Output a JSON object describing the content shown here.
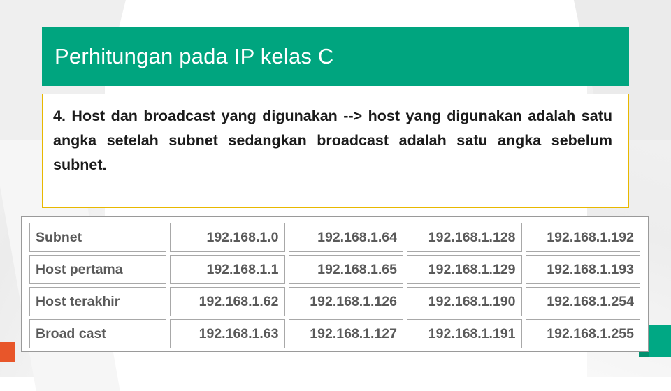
{
  "slide": {
    "title": "Perhitungan pada IP kelas C",
    "body": "4. Host dan broadcast yang digunakan --> host yang digunakan adalah satu angka setelah subnet sedangkan broadcast adalah satu angka sebelum subnet.",
    "accent_green": "#00a57f",
    "accent_yellow": "#e8b800",
    "accent_orange": "#e8562a"
  },
  "table": {
    "rows": [
      {
        "label": "Subnet",
        "values": [
          "192.168.1.0",
          "192.168.1.64",
          "192.168.1.128",
          "192.168.1.192"
        ]
      },
      {
        "label": "Host pertama",
        "values": [
          "192.168.1.1",
          "192.168.1.65",
          "192.168.1.129",
          "192.168.1.193"
        ]
      },
      {
        "label": "Host terakhir",
        "values": [
          "192.168.1.62",
          "192.168.1.126",
          "192.168.1.190",
          "192.168.1.254"
        ]
      },
      {
        "label": "Broad cast",
        "values": [
          "192.168.1.63",
          "192.168.1.127",
          "192.168.1.191",
          "192.168.1.255"
        ]
      }
    ]
  }
}
